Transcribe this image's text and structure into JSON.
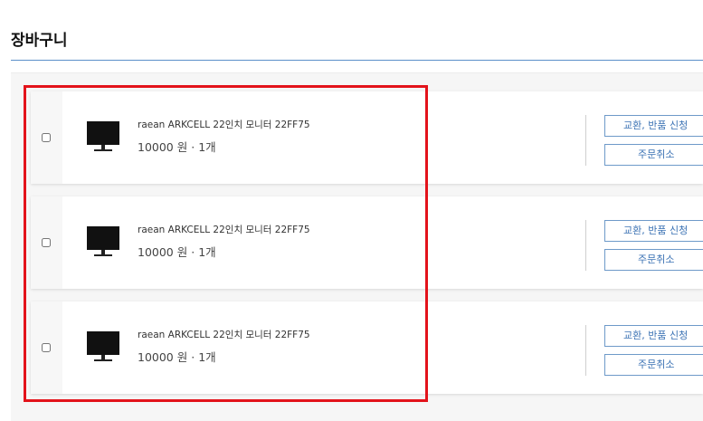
{
  "page": {
    "title": "장바구니"
  },
  "cart": {
    "items": [
      {
        "name": "raean ARKCELL 22인치 모니터 22FF75",
        "price": "10000 원",
        "separator": "·",
        "quantity": "1개",
        "exchange_label": "교환, 반품 신청",
        "cancel_label": "주문취소"
      },
      {
        "name": "raean ARKCELL 22인치 모니터 22FF75",
        "price": "10000 원",
        "separator": "·",
        "quantity": "1개",
        "exchange_label": "교환, 반품 신청",
        "cancel_label": "주문취소"
      },
      {
        "name": "raean ARKCELL 22인치 모니터 22FF75",
        "price": "10000 원",
        "separator": "·",
        "quantity": "1개",
        "exchange_label": "교환, 반품 신청",
        "cancel_label": "주문취소"
      }
    ]
  },
  "icons": {
    "product": "monitor-icon"
  },
  "colors": {
    "accent": "#3c73b4",
    "highlight": "#e3131b",
    "rule": "#5b8fc9"
  }
}
